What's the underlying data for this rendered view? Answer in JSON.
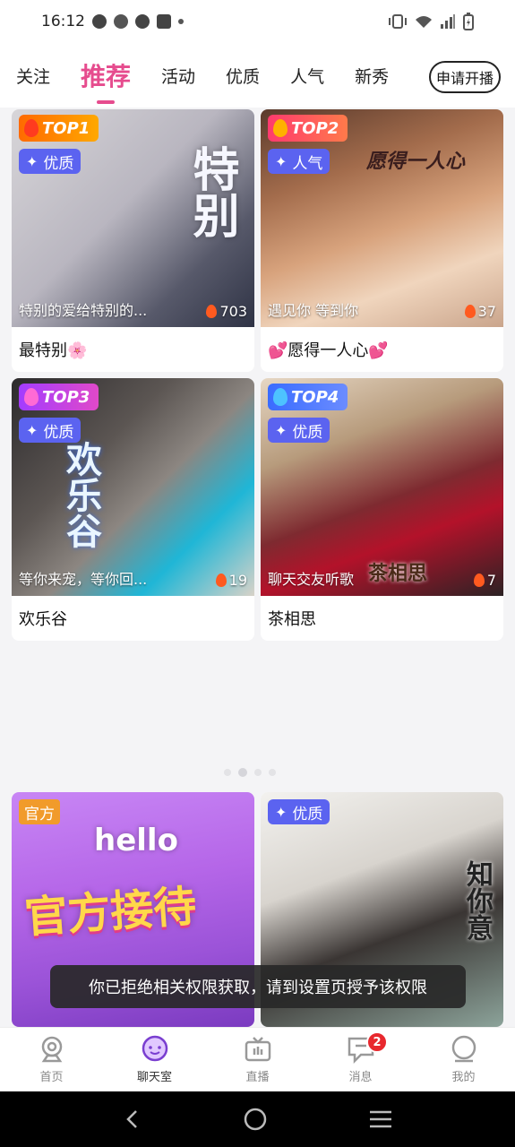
{
  "status_bar": {
    "time": "16:12"
  },
  "tabs": [
    {
      "label": "关注"
    },
    {
      "label": "推荐"
    },
    {
      "label": "活动"
    },
    {
      "label": "优质"
    },
    {
      "label": "人气"
    },
    {
      "label": "新秀"
    }
  ],
  "apply_button": "申请开播",
  "cards": [
    {
      "rank": "TOP1",
      "tag": "优质",
      "caption": "特别的爱给特别的...",
      "heat": "703",
      "name": "最特别🌸",
      "overlay": "特别"
    },
    {
      "rank": "TOP2",
      "tag": "人气",
      "caption": "遇见你 等到你",
      "heat": "37",
      "name": "💕愿得一人心💕",
      "overlay": "愿得一人心"
    },
    {
      "rank": "TOP3",
      "tag": "优质",
      "caption": "等你来宠，等你回...",
      "heat": "19",
      "name": "欢乐谷",
      "overlay": "欢乐谷"
    },
    {
      "rank": "TOP4",
      "tag": "优质",
      "caption": "聊天交友听歌",
      "heat": "7",
      "name": "茶相思",
      "overlay": "茶相思"
    },
    {
      "tag": "官方",
      "name": "",
      "overlay": "官方接待",
      "overlay2": "hello"
    },
    {
      "tag": "优质",
      "name": "",
      "overlay": "知你意"
    }
  ],
  "toast": "你已拒绝相关权限获取，请到设置页授予该权限",
  "bottom_nav": [
    {
      "label": "首页"
    },
    {
      "label": "聊天室"
    },
    {
      "label": "直播"
    },
    {
      "label": "消息",
      "badge": "2"
    },
    {
      "label": "我的"
    }
  ],
  "colors": {
    "accent": "#e64c8e",
    "quality_badge": "#5b63f0",
    "official_badge": "#f19b2b"
  }
}
